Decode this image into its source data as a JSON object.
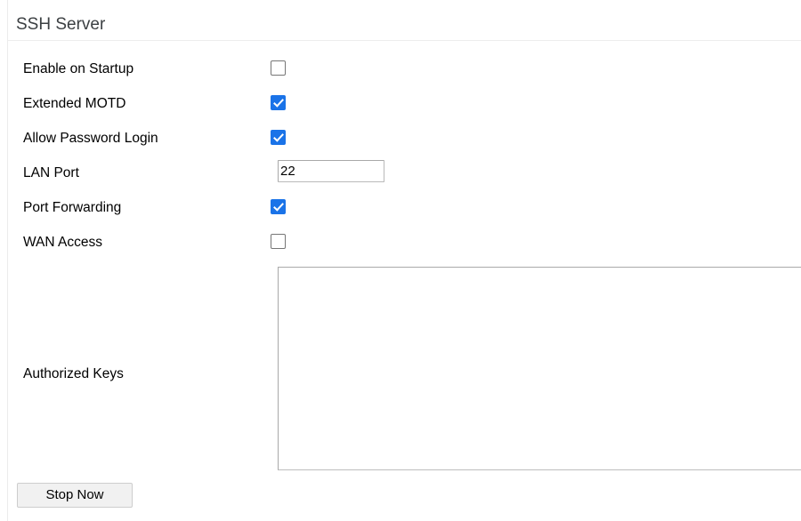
{
  "panel": {
    "title": "SSH Server"
  },
  "form": {
    "rows": [
      {
        "label": "Enable on Startup",
        "control": "checkbox",
        "checked": false,
        "name": "enable-on-startup"
      },
      {
        "label": "Extended MOTD",
        "control": "checkbox",
        "checked": true,
        "name": "extended-motd"
      },
      {
        "label": "Allow Password Login",
        "control": "checkbox",
        "checked": true,
        "name": "allow-password-login"
      },
      {
        "label": "LAN Port",
        "control": "text",
        "value": "22",
        "name": "lan-port"
      },
      {
        "label": "Port Forwarding",
        "control": "checkbox",
        "checked": true,
        "name": "port-forwarding"
      },
      {
        "label": "WAN Access",
        "control": "checkbox",
        "checked": false,
        "name": "wan-access"
      }
    ],
    "authorized_keys": {
      "label": "Authorized Keys",
      "value": "",
      "placeholder": ""
    }
  },
  "actions": {
    "primary_label": "Stop Now"
  },
  "colors": {
    "checkbox_checked": "#1a73e8",
    "checkbox_border": "#767676",
    "title_text": "#3c4043",
    "rule": "#ededed",
    "button_bg": "#f1f1f1",
    "button_border": "#cdcdcd",
    "field_border": "#b9b9b9"
  }
}
